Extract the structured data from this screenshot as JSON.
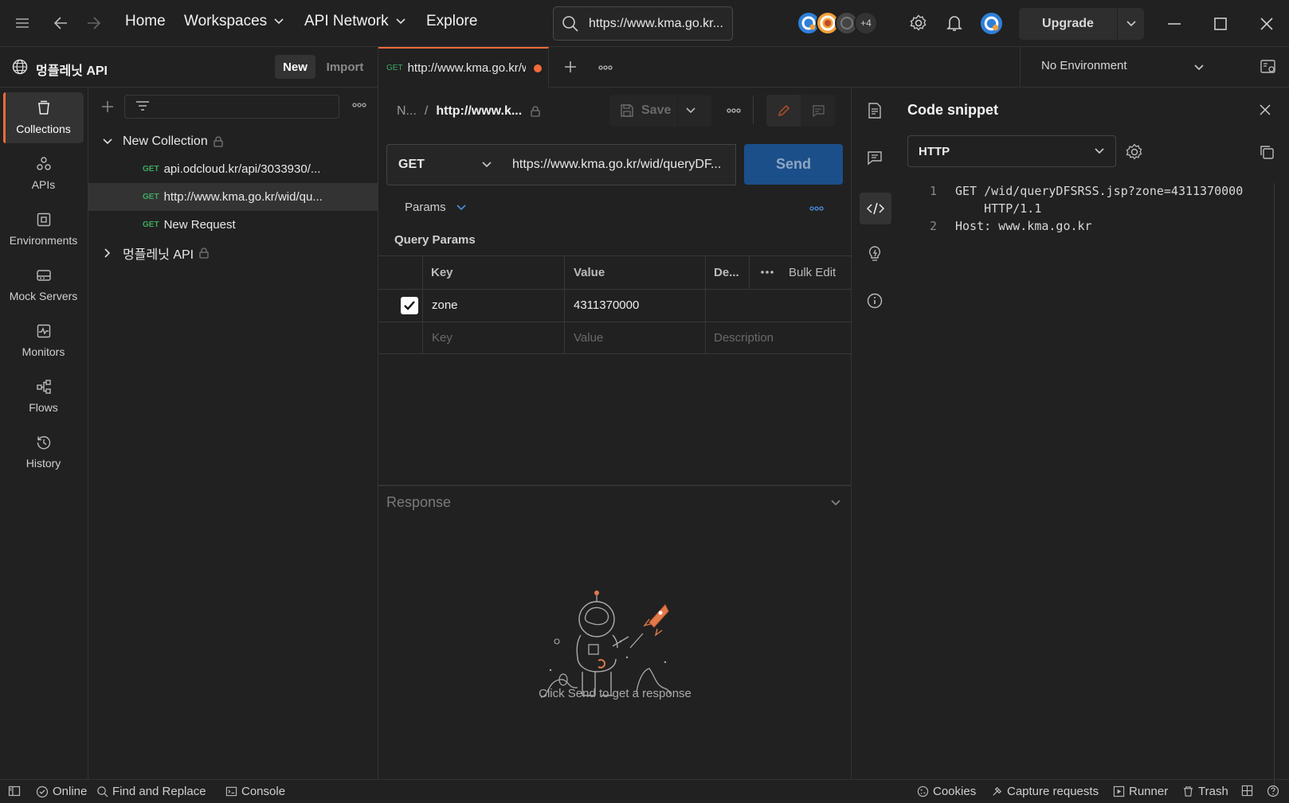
{
  "nav": {
    "home": "Home",
    "workspaces": "Workspaces",
    "api_network": "API Network",
    "explore": "Explore",
    "search_value": "https://www.kma.go.kr...",
    "avatar_extra": "+4",
    "upgrade": "Upgrade"
  },
  "workspace": {
    "name": "멍플레닛 API",
    "new_label": "New",
    "import_label": "Import"
  },
  "rail": [
    {
      "label": "Collections",
      "icon": "collections-icon"
    },
    {
      "label": "APIs",
      "icon": "apis-icon"
    },
    {
      "label": "Environments",
      "icon": "environments-icon"
    },
    {
      "label": "Mock Servers",
      "icon": "mock-servers-icon"
    },
    {
      "label": "Monitors",
      "icon": "monitors-icon"
    },
    {
      "label": "Flows",
      "icon": "flows-icon"
    },
    {
      "label": "History",
      "icon": "history-icon"
    }
  ],
  "tree": {
    "collection1": "New Collection",
    "req1_method": "GET",
    "req1_name": "api.odcloud.kr/api/3033930/...",
    "req2_method": "GET",
    "req2_name": "http://www.kma.go.kr/wid/qu...",
    "req3_method": "GET",
    "req3_name": "New Request",
    "collection2": "멍플레닛 API"
  },
  "tab": {
    "method": "GET",
    "title": "http://www.kma.go.kr/w"
  },
  "environment": "No Environment",
  "request": {
    "breadcrumb_parent": "N...",
    "breadcrumb_sep": "/",
    "breadcrumb_current": "http://www.k...",
    "save_label": "Save",
    "method": "GET",
    "url": "https://www.kma.go.kr/wid/queryDF...",
    "send_label": "Send",
    "params_tab": "Params",
    "query_params_title": "Query Params",
    "col_key": "Key",
    "col_value": "Value",
    "col_desc": "De...",
    "bulk_edit": "Bulk Edit",
    "param_key": "zone",
    "param_value": "4311370000",
    "placeholder_key": "Key",
    "placeholder_value": "Value",
    "placeholder_desc": "Description"
  },
  "response": {
    "title": "Response",
    "empty_text": "Click Send to get a response"
  },
  "code_snippet": {
    "title": "Code snippet",
    "language": "HTTP",
    "lines": [
      {
        "num": "1",
        "text": "GET /wid/queryDFSRSS.jsp?zone=4311370000"
      },
      {
        "num": "",
        "text": "    HTTP/1.1"
      },
      {
        "num": "2",
        "text": "Host: www.kma.go.kr"
      }
    ]
  },
  "status": {
    "online": "Online",
    "find_replace": "Find and Replace",
    "console": "Console",
    "cookies": "Cookies",
    "capture": "Capture requests",
    "runner": "Runner",
    "trash": "Trash"
  },
  "colors": {
    "accent": "#f26b3a",
    "send": "#1b4f8a",
    "get": "#3fa85f"
  }
}
